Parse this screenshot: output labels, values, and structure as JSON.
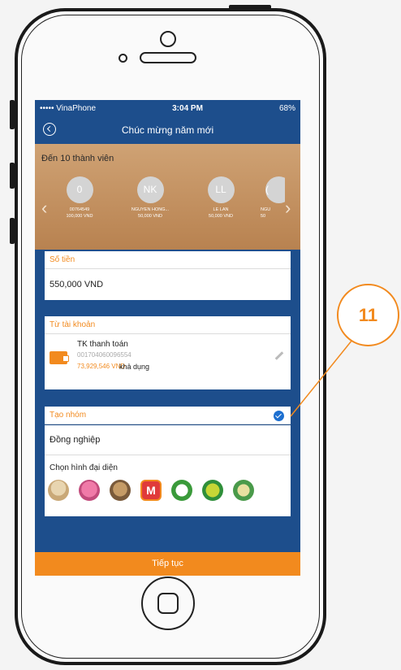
{
  "status_bar": {
    "carrier": "••••• VinaPhone",
    "time": "3:04 PM",
    "battery": "68%"
  },
  "header": {
    "title": "Chúc mừng năm mới"
  },
  "recipients": {
    "title": "Đến  10 thành viên",
    "items": [
      {
        "initials": "0",
        "name": "00764549",
        "amount": "100,000 VND"
      },
      {
        "initials": "NK",
        "name": "NGUYỄN HỒNG...",
        "amount": "50,000 VND"
      },
      {
        "initials": "LL",
        "name": "LE LAN",
        "amount": "50,000 VND"
      },
      {
        "initials": "(",
        "name": "NGU",
        "amount": "50"
      }
    ]
  },
  "amount_section": {
    "label": "Số tiền",
    "value": "550,000 VND"
  },
  "account_section": {
    "label": "Từ tài khoản",
    "name": "TK thanh toán",
    "number": "001704060096554",
    "balance": "73,929,546 VND",
    "available": "khả dụng"
  },
  "group_section": {
    "label": "Tạo nhóm",
    "name": "Đồng nghiệp",
    "avatar_label": "Chọn hình đại diện"
  },
  "avatars": [
    "old-man-avatar",
    "pink-creature-avatar",
    "dog-avatar",
    "m-logo-avatar",
    "soccer-ball-avatar",
    "tennis-ball-avatar",
    "partial-avatar"
  ],
  "continue_button": {
    "label": "Tiếp tục"
  },
  "callout": {
    "number": "11"
  },
  "colors": {
    "primary_blue": "#1d4e8c",
    "accent_orange": "#f28a1e",
    "check_blue": "#1d6fd0"
  }
}
